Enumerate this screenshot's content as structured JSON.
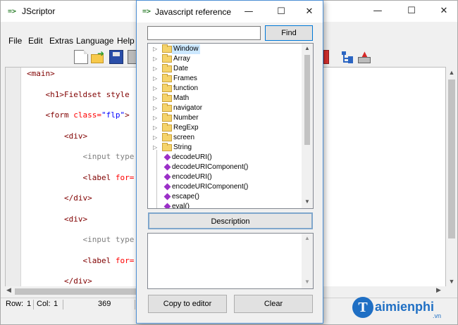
{
  "main_window": {
    "title": "JScriptor",
    "title_icon": "=>",
    "controls": {
      "minimize": "—",
      "maximize": "☐",
      "close": "✕"
    },
    "menu": [
      "File",
      "Edit",
      "Extras",
      "Language",
      "Help"
    ],
    "toolbar_icons": [
      "new-file-icon",
      "open-folder-icon",
      "save-icon",
      "print-icon",
      "tree-view-icon",
      "upload-icon"
    ],
    "code_lines": [
      {
        "indent": "",
        "parts": [
          [
            "tag",
            "<main>"
          ]
        ]
      },
      {
        "indent": "    ",
        "parts": [
          [
            "tag",
            "<h1>"
          ],
          [
            "tag",
            "Fieldset style"
          ]
        ]
      },
      {
        "indent": "    ",
        "parts": [
          [
            "tag",
            "<form "
          ],
          [
            "attr",
            "class="
          ],
          [
            "val",
            "\"flp\""
          ],
          [
            "tag",
            ">"
          ]
        ]
      },
      {
        "indent": "        ",
        "parts": [
          [
            "tag",
            "<div>"
          ]
        ]
      },
      {
        "indent": "            ",
        "parts": [
          [
            "gray",
            "<input type"
          ]
        ]
      },
      {
        "indent": "            ",
        "parts": [
          [
            "tag",
            "<label "
          ],
          [
            "attr",
            "for="
          ]
        ]
      },
      {
        "indent": "        ",
        "parts": [
          [
            "tag",
            "</div>"
          ]
        ]
      },
      {
        "indent": "        ",
        "parts": [
          [
            "tag",
            "<div>"
          ]
        ]
      },
      {
        "indent": "            ",
        "parts": [
          [
            "gray",
            "<input type"
          ]
        ]
      },
      {
        "indent": "            ",
        "parts": [
          [
            "tag",
            "<label "
          ],
          [
            "attr",
            "for="
          ]
        ]
      },
      {
        "indent": "        ",
        "parts": [
          [
            "tag",
            "</div>"
          ]
        ]
      }
    ],
    "status": {
      "row_label": "Row:",
      "row": "1",
      "col_label": "Col:",
      "col": "1",
      "position": "369"
    }
  },
  "reference_dialog": {
    "title": "Javascript reference",
    "title_icon": "=>",
    "controls": {
      "minimize": "—",
      "maximize": "☐",
      "close": "✕"
    },
    "search": {
      "value": "",
      "placeholder": ""
    },
    "find_label": "Find",
    "tree_folders": [
      "Window",
      "Array",
      "Date",
      "Frames",
      "function",
      "Math",
      "navigator",
      "Number",
      "RegExp",
      "screen",
      "String"
    ],
    "selected_folder": "Window",
    "tree_functions": [
      "decodeURI()",
      "decodeURIComponent()",
      "encodeURI()",
      "encodeURIComponent()",
      "escape()",
      "eval()"
    ],
    "description_label": "Description",
    "description_text": "",
    "copy_label": "Copy to editor",
    "clear_label": "Clear"
  },
  "watermark": {
    "initial": "T",
    "brand": "aimienphi",
    "tld": ".vn",
    "color": "#1f6fc4"
  },
  "colors": {
    "tag": "#800000",
    "attr": "#ff0000",
    "value": "#0000ff",
    "selection": "#cce8ff",
    "dialog_border": "#4d8fd4"
  }
}
